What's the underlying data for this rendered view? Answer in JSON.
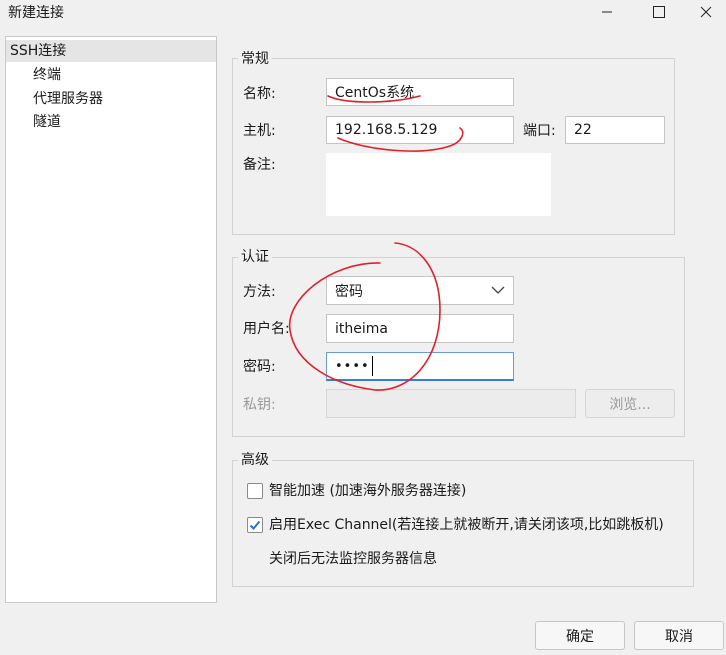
{
  "window": {
    "title": "新建连接"
  },
  "tree": {
    "items": [
      {
        "label": "SSH连接",
        "selected": true
      },
      {
        "label": "终端"
      },
      {
        "label": "代理服务器"
      },
      {
        "label": "隧道"
      }
    ]
  },
  "general": {
    "group_title": "常规",
    "name_label": "名称:",
    "name_value": "CentOs系统",
    "host_label": "主机:",
    "host_value": "192.168.5.129",
    "port_label": "端口:",
    "port_value": "22",
    "note_label": "备注:",
    "note_value": ""
  },
  "auth": {
    "group_title": "认证",
    "method_label": "方法:",
    "method_value": "密码",
    "user_label": "用户名:",
    "user_value": "itheima",
    "password_label": "密码:",
    "password_mask": "••••",
    "key_label": "私钥:",
    "key_value": "",
    "browse_label": "浏览..."
  },
  "advanced": {
    "group_title": "高级",
    "accel_label": "智能加速 (加速海外服务器连接)",
    "accel_checked": false,
    "exec_label": "启用Exec Channel(若连接上就被断开,请关闭该项,比如跳板机)",
    "exec_checked": true,
    "exec_note": "关闭后无法监控服务器信息"
  },
  "footer": {
    "ok_label": "确定",
    "cancel_label": "取消"
  },
  "colors": {
    "annotation_red": "#e0202a",
    "check_blue": "#2f6fd0"
  },
  "icons": {
    "minimize": "minimize-icon",
    "maximize": "maximize-icon",
    "close": "close-icon",
    "dropdown": "chevron-down-icon",
    "checkmark": "checkmark-icon"
  }
}
